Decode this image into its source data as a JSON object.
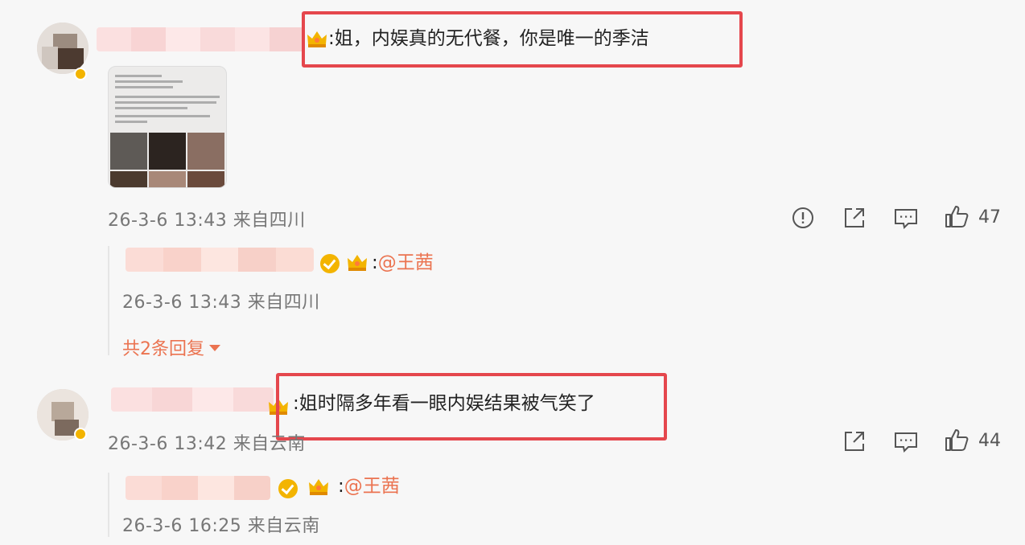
{
  "comments": [
    {
      "text": ":姐，内娱真的无代餐，你是唯一的季洁",
      "meta": "26-3-6 13:43 来自四川",
      "likes": "47",
      "reply": {
        "prefix": ":",
        "mention": "@王茜",
        "meta": "26-3-6 13:43 来自四川"
      },
      "more_replies": "共2条回复"
    },
    {
      "text": ":姐时隔多年看一眼内娱结果被气笑了",
      "meta": "26-3-6 13:42 来自云南",
      "likes": "44",
      "reply": {
        "prefix": ":",
        "mention": "@王茜",
        "meta": "26-3-6 16:25 来自云南"
      }
    }
  ],
  "icons": [
    "report-icon",
    "share-icon",
    "comment-icon",
    "like-icon",
    "crown-icon",
    "verified-icon"
  ],
  "colors": {
    "accent": "#eb7350",
    "highlight_box": "#e5474d",
    "meta": "#777777",
    "verified": "#f3b400"
  }
}
